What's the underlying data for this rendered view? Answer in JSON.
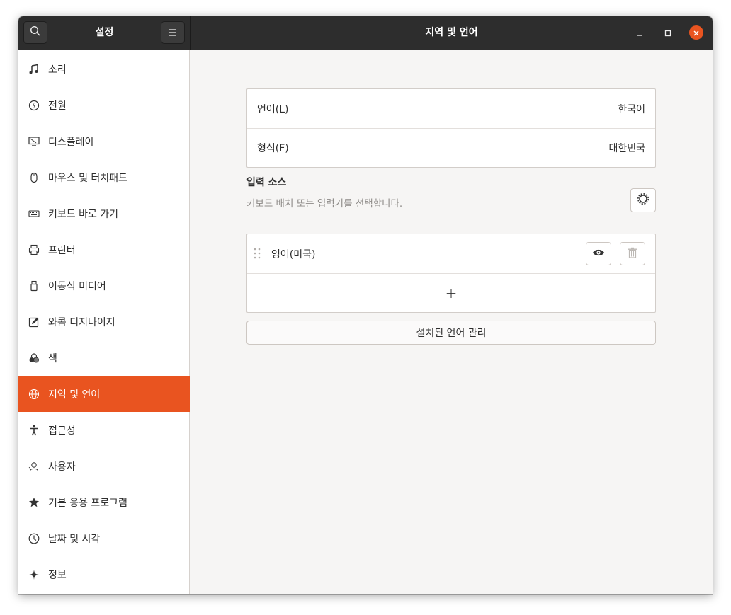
{
  "header": {
    "sidebar_title": "설정",
    "title": "지역 및 언어",
    "accent_color": "#e95420"
  },
  "sidebar": {
    "items": [
      {
        "label": "소리",
        "icon": "music-note-icon"
      },
      {
        "label": "전원",
        "icon": "power-icon"
      },
      {
        "label": "디스플레이",
        "icon": "display-icon"
      },
      {
        "label": "마우스 및 터치패드",
        "icon": "mouse-icon"
      },
      {
        "label": "키보드 바로 가기",
        "icon": "keyboard-icon"
      },
      {
        "label": "프린터",
        "icon": "printer-icon"
      },
      {
        "label": "이동식 미디어",
        "icon": "usb-drive-icon"
      },
      {
        "label": "와콤 디지타이저",
        "icon": "tablet-pen-icon"
      },
      {
        "label": "색",
        "icon": "color-circles-icon"
      },
      {
        "label": "지역 및 언어",
        "icon": "globe-icon",
        "active": true
      },
      {
        "label": "접근성",
        "icon": "accessibility-icon"
      },
      {
        "label": "사용자",
        "icon": "users-icon"
      },
      {
        "label": "기본 응용 프로그램",
        "icon": "star-icon"
      },
      {
        "label": "날짜 및 시각",
        "icon": "clock-icon"
      },
      {
        "label": "정보",
        "icon": "sparkle-icon"
      }
    ]
  },
  "region": {
    "language_label": "언어(L)",
    "language_value": "한국어",
    "formats_label": "형식(F)",
    "formats_value": "대한민국"
  },
  "input_sources": {
    "title": "입력 소스",
    "subtitle": "키보드 배치 또는 입력기를 선택합니다.",
    "items": [
      {
        "label": "영어(미국)"
      }
    ],
    "add_symbol": "+"
  },
  "manage_button": "설치된 언어 관리"
}
